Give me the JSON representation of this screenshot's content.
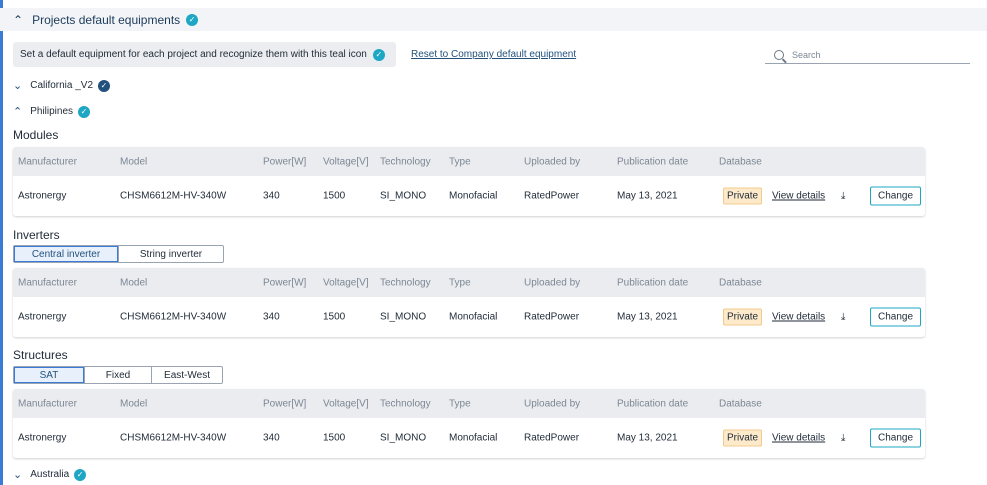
{
  "header": {
    "title": "Projects default equipments",
    "chevron": "chevron-up-icon"
  },
  "info": {
    "text": "Set a default equipment for each project and recognize them with this teal icon",
    "reset_link": "Reset to Company default equipment"
  },
  "search": {
    "placeholder": "Search",
    "value": ""
  },
  "projects": [
    {
      "name": "California _V2",
      "expanded": false,
      "check_color": "#23517d"
    },
    {
      "name": "Philipines",
      "expanded": true,
      "check_color": "#1ea7c5"
    },
    {
      "name": "Australia",
      "expanded": false,
      "check_color": "#1ea7c5"
    }
  ],
  "columns": [
    "Manufacturer",
    "Model",
    "Power[W]",
    "Voltage[V]",
    "Technology",
    "Type",
    "Uploaded by",
    "Publication date",
    "Database"
  ],
  "modules": {
    "label": "Modules",
    "row": {
      "manufacturer": "Astronergy",
      "model": "CHSM6612M-HV-340W",
      "power": "340",
      "voltage": "1500",
      "technology": "SI_MONO",
      "type": "Monofacial",
      "uploaded_by": "RatedPower",
      "date": "May 13, 2021",
      "database": "Private",
      "view": "View details",
      "change": "Change"
    }
  },
  "inverters": {
    "label": "Inverters",
    "tabs": [
      "Central inverter",
      "String inverter"
    ],
    "active_tab": 0,
    "row": {
      "manufacturer": "Astronergy",
      "model": "CHSM6612M-HV-340W",
      "power": "340",
      "voltage": "1500",
      "technology": "SI_MONO",
      "type": "Monofacial",
      "uploaded_by": "RatedPower",
      "date": "May 13, 2021",
      "database": "Private",
      "view": "View details",
      "change": "Change"
    }
  },
  "structures": {
    "label": "Structures",
    "tabs": [
      "SAT",
      "Fixed",
      "East-West"
    ],
    "active_tab": 0,
    "row": {
      "manufacturer": "Astronergy",
      "model": "CHSM6612M-HV-340W",
      "power": "340",
      "voltage": "1500",
      "technology": "SI_MONO",
      "type": "Monofacial",
      "uploaded_by": "RatedPower",
      "date": "May 13, 2021",
      "database": "Private",
      "view": "View details",
      "change": "Change"
    }
  },
  "colors": {
    "accent": "#23517d",
    "teal": "#1ea7c5",
    "badge_bg": "#fdeacb",
    "badge_text": "#e08a1e"
  }
}
